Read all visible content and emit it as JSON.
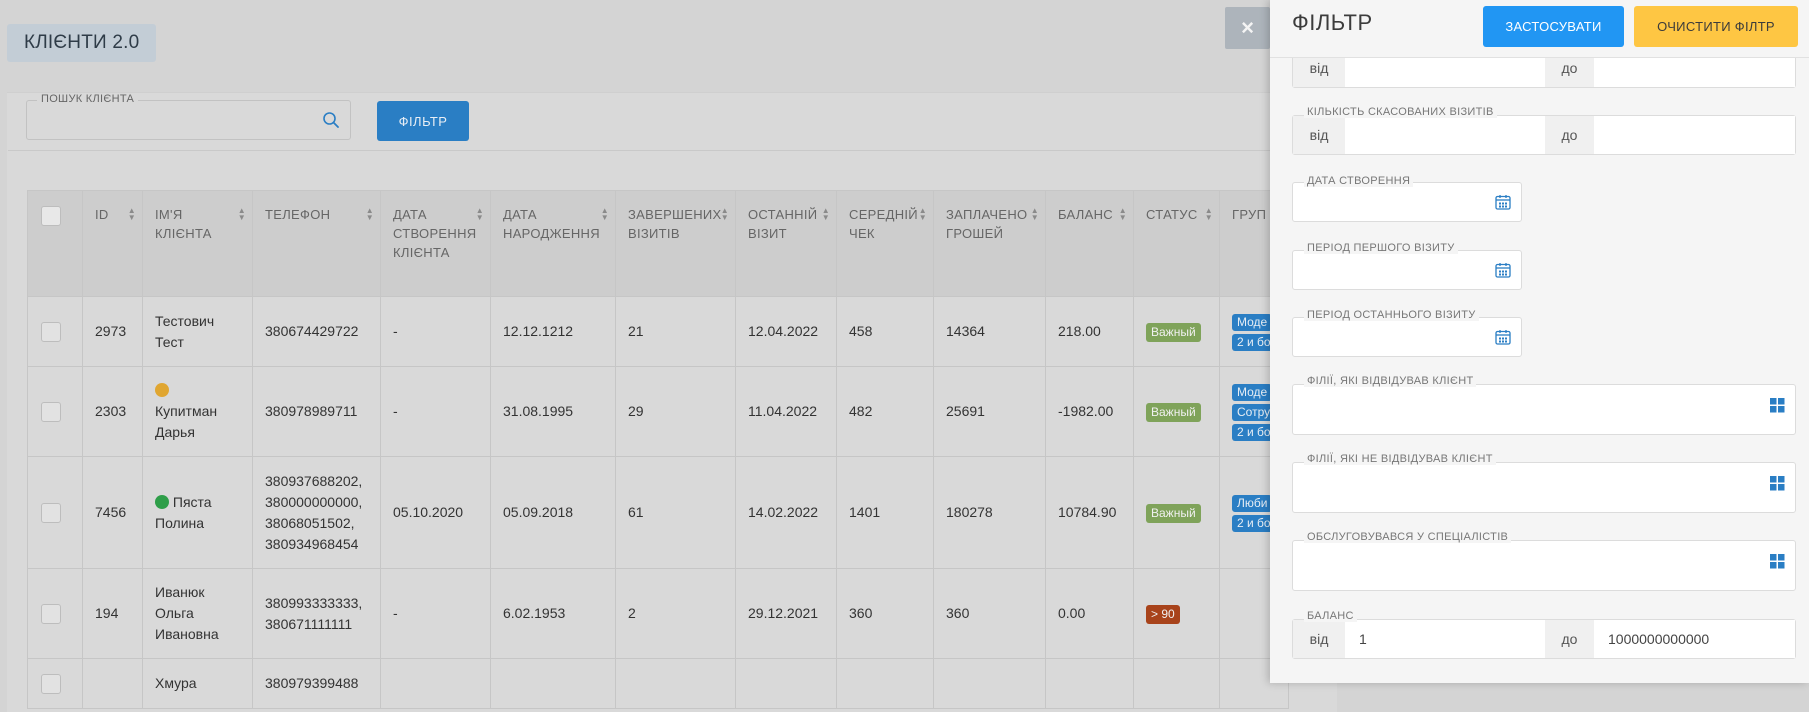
{
  "page": {
    "title": "КЛІЄНТИ 2.0"
  },
  "search": {
    "label": "ПОШУК КЛІЄНТА",
    "value": ""
  },
  "toolbar": {
    "filter_label": "ФІЛЬТР"
  },
  "close": {
    "label": "×"
  },
  "table": {
    "columns": [
      {
        "key": "id",
        "label": "ID"
      },
      {
        "key": "name",
        "label": "ІМ'Я КЛІЄНТА"
      },
      {
        "key": "phone",
        "label": "ТЕЛЕФОН"
      },
      {
        "key": "created",
        "label": "ДАТА СТВОРЕННЯ КЛІЄНТА"
      },
      {
        "key": "birth",
        "label": "ДАТА НАРОДЖЕННЯ"
      },
      {
        "key": "completed",
        "label": "ЗАВЕРШЕНИХ ВІЗИТІВ"
      },
      {
        "key": "last",
        "label": "ОСТАННІЙ ВІЗИТ"
      },
      {
        "key": "avg",
        "label": "СЕРЕДНІЙ ЧЕК"
      },
      {
        "key": "paid",
        "label": "ЗАПЛАЧЕНО ГРОШЕЙ"
      },
      {
        "key": "balance",
        "label": "БАЛАНС"
      },
      {
        "key": "status",
        "label": "СТАТУС"
      },
      {
        "key": "groups",
        "label": "ГРУП"
      }
    ],
    "rows": [
      {
        "id": "2973",
        "name": "Тестович Тест",
        "dot": "",
        "phones": [
          "380674429722"
        ],
        "created": "-",
        "birth": "12.12.1212",
        "completed": "21",
        "last": "12.04.2022",
        "avg": "458",
        "paid": "14364",
        "balance": "218.00",
        "status": "Важный",
        "status_color": "#7fa35a",
        "groups": [
          "Моде",
          "2 и бо"
        ]
      },
      {
        "id": "2303",
        "name": "Купитман Дарья",
        "dot": "#e0a631",
        "phones": [
          "380978989711"
        ],
        "created": "-",
        "birth": "31.08.1995",
        "completed": "29",
        "last": "11.04.2022",
        "avg": "482",
        "paid": "25691",
        "balance": "-1982.00",
        "status": "Важный",
        "status_color": "#7fa35a",
        "groups": [
          "Моде",
          "Сотру",
          "2 и бо"
        ]
      },
      {
        "id": "7456",
        "name": "Пяста Полина",
        "dot": "#2e9e49",
        "phones": [
          "380937688202,",
          "380000000000,",
          "38068051502,",
          "380934968454"
        ],
        "created": "05.10.2020",
        "birth": "05.09.2018",
        "completed": "61",
        "last": "14.02.2022",
        "avg": "1401",
        "paid": "180278",
        "balance": "10784.90",
        "status": "Важный",
        "status_color": "#7fa35a",
        "groups": [
          "Люби",
          "2 и бо"
        ]
      },
      {
        "id": "194",
        "name": "Иванюк Ольга Ивановна",
        "dot": "",
        "phones": [
          "380993333333,",
          "380671111111"
        ],
        "created": "-",
        "birth": "6.02.1953",
        "completed": "2",
        "last": "29.12.2021",
        "avg": "360",
        "paid": "360",
        "balance": "0.00",
        "status": "> 90",
        "status_color": "#a8431b",
        "groups": []
      },
      {
        "id": "",
        "name": "Хмура",
        "dot": "",
        "phones": [
          "380979399488"
        ],
        "created": "",
        "birth": "",
        "completed": "",
        "last": "",
        "avg": "",
        "paid": "",
        "balance": "",
        "status": "",
        "status_color": "",
        "groups": []
      }
    ]
  },
  "filter_panel": {
    "title": "ФІЛЬТР",
    "apply_label": "ЗАСТОСУВАТИ",
    "clear_label": "ОЧИСТИТИ ФІЛТР",
    "from_label": "від",
    "to_label": "до",
    "visits_range": {
      "from": "",
      "to": ""
    },
    "cancelled": {
      "label": "КІЛЬКІСТЬ СКАСОВАНИХ ВІЗИТІВ",
      "from": "",
      "to": ""
    },
    "created_date": {
      "label": "ДАТА СТВОРЕННЯ",
      "value": ""
    },
    "first_visit": {
      "label": "ПЕРІОД ПЕРШОГО ВІЗИТУ",
      "value": ""
    },
    "last_visit": {
      "label": "ПЕРІОД ОСТАННЬОГО ВІЗИТУ",
      "value": ""
    },
    "visited_branches": {
      "label": "ФІЛІЇ, ЯКІ ВІДВІДУВАВ КЛІЄНТ",
      "value": ""
    },
    "not_visited_branches": {
      "label": "ФІЛІЇ, ЯКІ НЕ ВІДВІДУВАВ КЛІЄНТ",
      "value": ""
    },
    "specialists": {
      "label": "ОБСЛУГОВУВАВСЯ У СПЕЦІАЛІСТІВ",
      "value": ""
    },
    "balance": {
      "label": "БАЛАНС",
      "from": "1",
      "to": "1000000000000"
    }
  },
  "colors": {
    "primary": "#2196f3",
    "warning": "#fec643",
    "tag": "#2a7ec4"
  }
}
